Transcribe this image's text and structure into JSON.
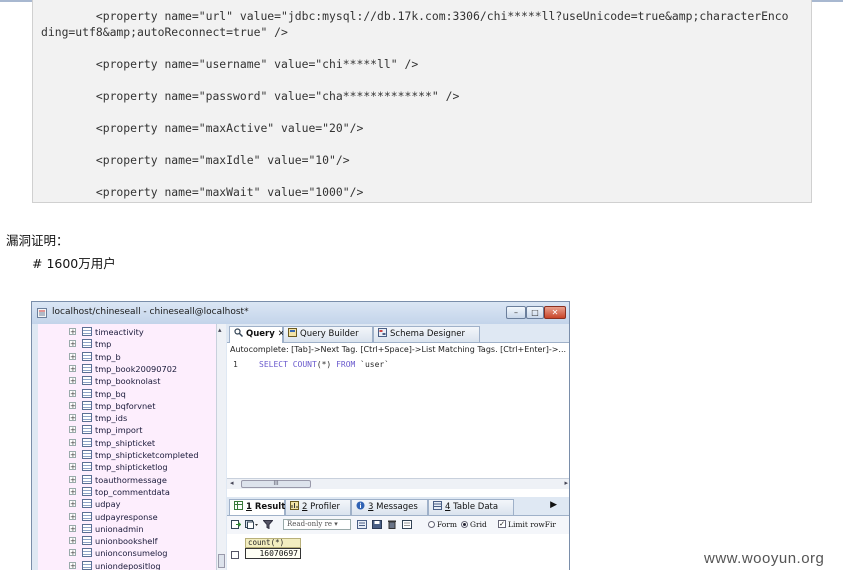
{
  "code": {
    "lines": [
      "        <property name=\"url\" value=\"jdbc:mysql://db.17k.com:3306/chi*****ll?useUnicode=true&amp;characterEnco",
      "ding=utf8&amp;autoReconnect=true\" />",
      "",
      "        <property name=\"username\" value=\"chi*****ll\" />",
      "",
      "        <property name=\"password\" value=\"cha*************\" />",
      "",
      "        <property name=\"maxActive\" value=\"20\"/>",
      "",
      "        <property name=\"maxIdle\" value=\"10\"/>",
      "",
      "        <property name=\"maxWait\" value=\"1000\"/>"
    ]
  },
  "labels": {
    "vuln_proof": "漏洞证明：",
    "users_note": "# 1600万用户"
  },
  "window": {
    "title": "localhost/chineseall - chineseall@localhost*",
    "min_glyph": "–",
    "max_glyph": "□",
    "close_glyph": "✕"
  },
  "tree": {
    "expander_glyph": "+",
    "items": [
      "timeactivity",
      "tmp",
      "tmp_b",
      "tmp_book20090702",
      "tmp_booknolast",
      "tmp_bq",
      "tmp_bqforvnet",
      "tmp_ids",
      "tmp_import",
      "tmp_shipticket",
      "tmp_shipticketcompleted",
      "tmp_shipticketlog",
      "toauthormessage",
      "top_commentdata",
      "udpay",
      "udpayresponse",
      "unionadmin",
      "unionbookshelf",
      "unionconsumelog",
      "uniondepositlog"
    ]
  },
  "query_tabs": [
    {
      "label": "Query ✕",
      "icon": "magnifier-icon"
    },
    {
      "label": "Query Builder",
      "icon": "builder-icon"
    },
    {
      "label": "Schema Designer",
      "icon": "schema-icon"
    }
  ],
  "autocomplete_hint": "Autocomplete: [Tab]->Next Tag. [Ctrl+Space]->List Matching Tags. [Ctrl+Enter]->... ",
  "editor": {
    "line_number": "1",
    "sql_keyword_1": "SELECT COUNT",
    "sql_mid": "(*) ",
    "sql_keyword_2": "FROM",
    "sql_table": " `user`"
  },
  "scrollbar": {
    "left_arrow": "◂",
    "grip": "III",
    "right_arrow": "▸",
    "up_arrow": "▴"
  },
  "result_tabs": [
    {
      "num": "1",
      "label": " Result"
    },
    {
      "num": "2",
      "label": " Profiler"
    },
    {
      "num": "3",
      "label": " Messages"
    },
    {
      "num": "4",
      "label": " Table Data"
    }
  ],
  "result_tabs_arrow": "▶",
  "toolbar": {
    "readonly_select": "Read-only re ▾",
    "form_label": "Form",
    "grid_label": "Grid",
    "limit_label": "Limit rowFir",
    "limit_check": "✓"
  },
  "grid": {
    "column_header": "count(*)",
    "value": "16070697"
  },
  "footer": "www.wooyun.org",
  "colors": {
    "tree_background": "#fdeefd",
    "sql_keyword": "#6a5acd",
    "column_header_bg": "#f3eec0"
  }
}
